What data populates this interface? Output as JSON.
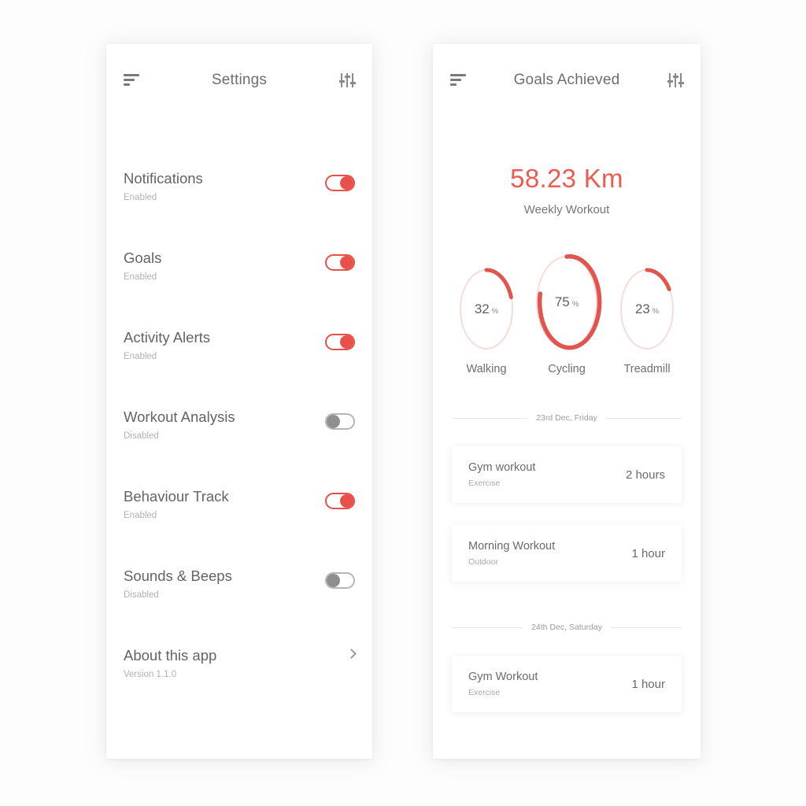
{
  "theme": {
    "accent_red": "#E8504A",
    "hero_red": "#EC5B52",
    "track_pink": "#F7DCDA",
    "text_dark": "#636368",
    "text_muted": "#B2B2B6",
    "page_bg": "#FDFDFD",
    "panel_bg": "#FFFFFF"
  },
  "settings_screen": {
    "header": {
      "menu_icon": "menu-icon",
      "title": "Settings",
      "filter_icon": "sliders-icon"
    },
    "rows": [
      {
        "label": "Notifications",
        "status": "Enabled",
        "toggle": "on"
      },
      {
        "label": "Goals",
        "status": "Enabled",
        "toggle": "on"
      },
      {
        "label": "Activity Alerts",
        "status": "Enabled",
        "toggle": "on"
      },
      {
        "label": "Workout Analysis",
        "status": "Disabled",
        "toggle": "off"
      },
      {
        "label": "Behaviour Track",
        "status": "Enabled",
        "toggle": "on"
      },
      {
        "label": "Sounds & Beeps",
        "status": "Disabled",
        "toggle": "off"
      }
    ],
    "about": {
      "label": "About this app",
      "version": "Version 1.1.0",
      "chevron_icon": "chevron-right-icon"
    }
  },
  "goals_screen": {
    "header": {
      "menu_icon": "menu-icon",
      "title": "Goals Achieved",
      "filter_icon": "sliders-icon"
    },
    "hero": {
      "distance": "58.23 Km",
      "caption": "Weekly Workout"
    },
    "rings": [
      {
        "label": "Walking",
        "value": "32",
        "percent_sign": "%",
        "percent": 32,
        "size": "small"
      },
      {
        "label": "Cycling",
        "value": "75",
        "percent_sign": "%",
        "percent": 75,
        "size": "large"
      },
      {
        "label": "Treadmill",
        "value": "23",
        "percent_sign": "%",
        "percent": 23,
        "size": "small"
      }
    ],
    "sections": [
      {
        "date": "23rd Dec, Friday",
        "entries": [
          {
            "title": "Gym workout",
            "type": "Exercise",
            "duration": "2 hours"
          },
          {
            "title": "Morning Workout",
            "type": "Outdoor",
            "duration": "1 hour"
          }
        ]
      },
      {
        "date": "24th Dec, Saturday",
        "entries": [
          {
            "title": "Gym Workout",
            "type": "Exercise",
            "duration": "1 hour"
          }
        ]
      }
    ]
  },
  "chart_data": {
    "type": "pie",
    "title": "Goals Achieved — Weekly Workout",
    "categories": [
      "Walking",
      "Cycling",
      "Treadmill"
    ],
    "values": [
      32,
      75,
      23
    ],
    "unit": "%",
    "ylim": [
      0,
      100
    ],
    "annotations": [
      "58.23 Km total weekly distance"
    ]
  }
}
